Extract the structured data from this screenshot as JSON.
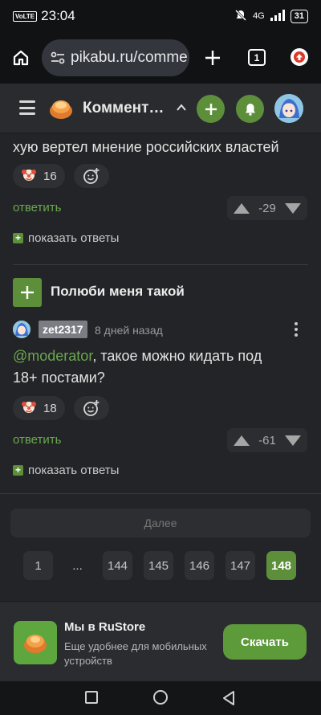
{
  "status_bar": {
    "volte": "VoLTE",
    "time": "23:04",
    "network": "4G",
    "battery": "31"
  },
  "browser": {
    "url": "pikabu.ru/comme",
    "tab_count": "1"
  },
  "site_header": {
    "title": "Коммент…"
  },
  "comment_1": {
    "text": "хую вертел мнение российских властей",
    "reaction_count": "16",
    "reply_label": "ответить",
    "rating": "-29",
    "show_replies": "показать ответы"
  },
  "comment_2": {
    "post_title": "Полюби меня такой",
    "username": "zet2317",
    "time_ago": "8 дней назад",
    "mention": "@moderator",
    "text_line1_rest": ", такое можно кидать под",
    "text_line2": "18+ постами?",
    "reaction_count": "18",
    "reply_label": "ответить",
    "rating": "-61",
    "show_replies": "показать ответы"
  },
  "pagination": {
    "next_label": "Далее",
    "pages": [
      "1",
      "...",
      "144",
      "145",
      "146",
      "147",
      "148"
    ],
    "current": "148"
  },
  "rustore_banner": {
    "title": "Мы в RuStore",
    "subtitle": "Еще удобнее для мобильных устройств",
    "button": "Скачать"
  },
  "colors": {
    "accent_green": "#5d8f3b",
    "link_green": "#6aa84f",
    "background": "#232427"
  }
}
